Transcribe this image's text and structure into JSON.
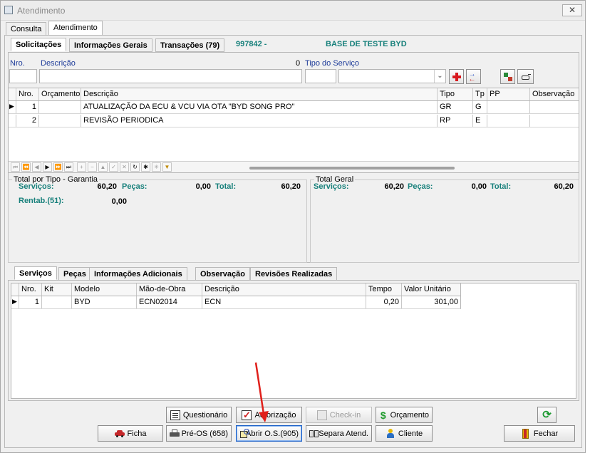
{
  "window": {
    "title": "Atendimento",
    "close_glyph": "✕"
  },
  "top_tabs": [
    "Consulta",
    "Atendimento"
  ],
  "inner_tabs": [
    "Solicitações",
    "Informações Gerais",
    "Transações (79)"
  ],
  "header_info": {
    "code": "997842 -",
    "base": "BASE DE TESTE BYD"
  },
  "solicitacao_form": {
    "nro_label": "Nro.",
    "descricao_label": "Descrição",
    "count": "0",
    "tipo_servico_label": "Tipo do Serviço",
    "nro_value": "",
    "descricao_value": "",
    "tipo_code_value": "",
    "tipo_select_value": ""
  },
  "solicitacoes_grid": {
    "columns": [
      "Nro.",
      "Orçamento",
      "Descrição",
      "Tipo",
      "Tp",
      "PP",
      "Observação"
    ],
    "rows": [
      {
        "nro": "1",
        "orcamento": "",
        "descricao": "ATUALIZAÇÃO DA ECU & VCU VIA OTA \"BYD SONG PRO\"",
        "tipo": "GR",
        "tp": "G",
        "pp": "",
        "obs": ""
      },
      {
        "nro": "2",
        "orcamento": "",
        "descricao": "REVISÃO PERIODICA",
        "tipo": "RP",
        "tp": "E",
        "pp": "",
        "obs": ""
      }
    ]
  },
  "totals_tipo": {
    "title": "Total por Tipo - Garantia",
    "servicos_label": "Serviços:",
    "servicos": "60,20",
    "pecas_label": "Peças:",
    "pecas": "0,00",
    "total_label": "Total:",
    "total": "60,20",
    "rentab_label": "Rentab.(51):",
    "rentab": "0,00"
  },
  "totals_geral": {
    "title": "Total Geral",
    "servicos_label": "Serviços:",
    "servicos": "60,20",
    "pecas_label": "Peças:",
    "pecas": "0,00",
    "total_label": "Total:",
    "total": "60,20"
  },
  "detail_tabs": [
    "Serviços",
    "Peças",
    "Informações Adicionais",
    "Observação",
    "Revisões Realizadas"
  ],
  "servicos_grid": {
    "columns": [
      "Nro.",
      "Kit",
      "Modelo",
      "Mão-de-Obra",
      "Descrição",
      "Tempo",
      "Valor Unitário"
    ],
    "rows": [
      {
        "nro": "1",
        "kit": "",
        "modelo": "BYD",
        "mao": "ECN02014",
        "descricao": "ECN",
        "tempo": "0,20",
        "valor": "301,00"
      }
    ]
  },
  "buttons": {
    "questionario": "Questionário",
    "autorizacao": "Autorização",
    "checkin": "Check-in",
    "orcamento": "Orçamento",
    "ficha": "Ficha",
    "pre_os": "Pré-OS (658)",
    "abrir_os": "Abrir O.S.(905)",
    "separa": "Separa Atend.",
    "cliente": "Cliente",
    "fechar": "Fechar"
  },
  "colors": {
    "teal": "#17807b",
    "label_blue": "#1e3c9a",
    "arrow": "#e0201b"
  }
}
